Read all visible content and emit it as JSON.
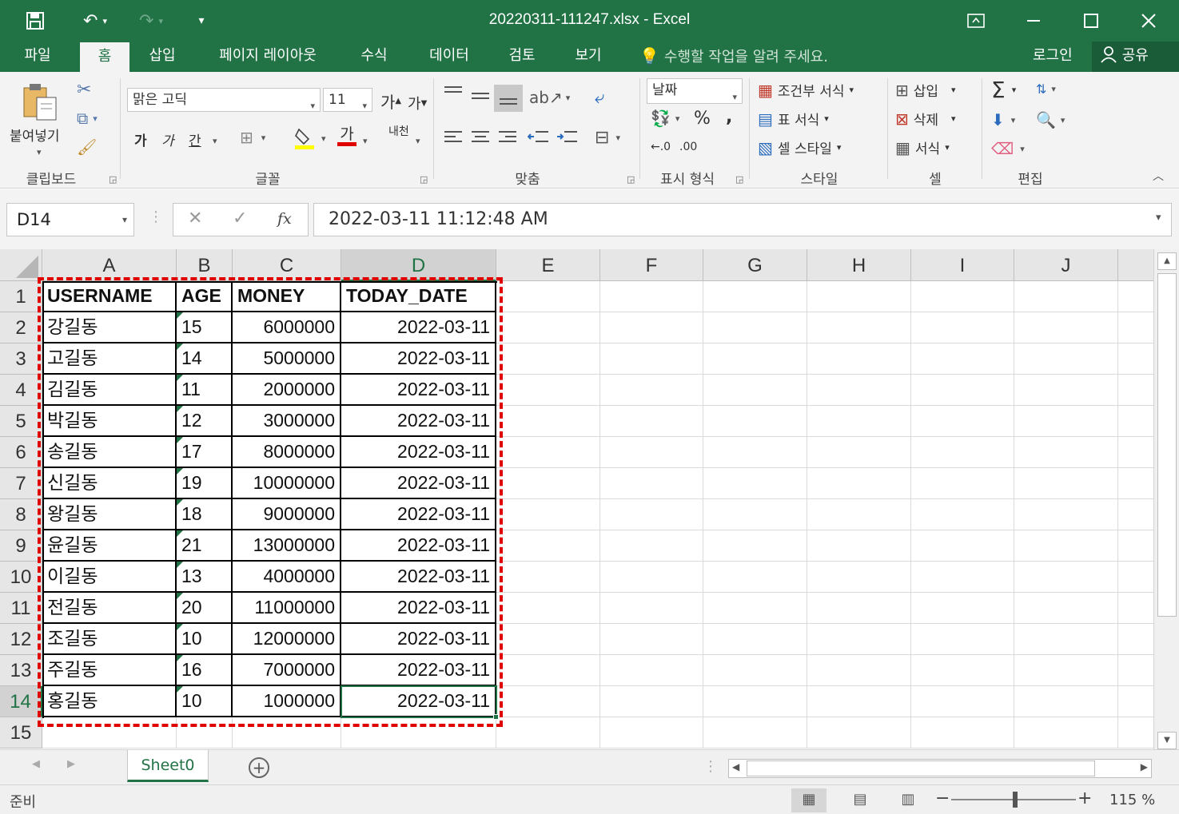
{
  "window": {
    "title": "20220311-111247.xlsx - Excel",
    "qat": {
      "save_icon": "save-icon",
      "undo_icon": "undo-icon",
      "redo_icon": "redo-icon"
    }
  },
  "tabs": [
    "파일",
    "홈",
    "삽입",
    "페이지 레이아웃",
    "수식",
    "데이터",
    "검토",
    "보기"
  ],
  "tell_me": "수행할 작업을 알려 주세요.",
  "login": "로그인",
  "share": "공유",
  "ribbon": {
    "clipboard": {
      "paste": "붙여넣기",
      "label": "클립보드"
    },
    "font": {
      "name": "맑은 고딕",
      "size": "11",
      "bold": "가",
      "italic": "가",
      "underline": "간",
      "grow": "가",
      "shrink": "가",
      "fontcolor": "가",
      "phonetic": "내천",
      "label": "글꼴"
    },
    "align": {
      "label": "맞춤"
    },
    "number": {
      "format": "날짜",
      "percent": "%",
      "comma": ",",
      "inc": "←.0",
      "dec": ".00",
      "label": "표시 형식"
    },
    "styles": {
      "conditional": "조건부 서식",
      "table": "표 서식",
      "cell": "셀 스타일",
      "label": "스타일"
    },
    "cells": {
      "insert": "삽입",
      "delete": "삭제",
      "format": "서식",
      "label": "셀"
    },
    "editing": {
      "sum": "Σ",
      "label": "편집"
    }
  },
  "formula_bar": {
    "name_box": "D14",
    "cancel": "✕",
    "enter": "✓",
    "fx": "fx",
    "value": "2022-03-11  11:12:48 AM"
  },
  "columns": [
    "A",
    "B",
    "C",
    "D",
    "E",
    "F",
    "G",
    "H",
    "I",
    "J"
  ],
  "rows": [
    "1",
    "2",
    "3",
    "4",
    "5",
    "6",
    "7",
    "8",
    "9",
    "10",
    "11",
    "12",
    "13",
    "14",
    "15"
  ],
  "table": {
    "headers": [
      "USERNAME",
      "AGE",
      "MONEY",
      "TODAY_DATE"
    ],
    "data": [
      [
        "강길동",
        "15",
        "6000000",
        "2022-03-11"
      ],
      [
        "고길동",
        "14",
        "5000000",
        "2022-03-11"
      ],
      [
        "김길동",
        "11",
        "2000000",
        "2022-03-11"
      ],
      [
        "박길동",
        "12",
        "3000000",
        "2022-03-11"
      ],
      [
        "송길동",
        "17",
        "8000000",
        "2022-03-11"
      ],
      [
        "신길동",
        "19",
        "10000000",
        "2022-03-11"
      ],
      [
        "왕길동",
        "18",
        "9000000",
        "2022-03-11"
      ],
      [
        "윤길동",
        "21",
        "13000000",
        "2022-03-11"
      ],
      [
        "이길동",
        "13",
        "4000000",
        "2022-03-11"
      ],
      [
        "전길동",
        "20",
        "11000000",
        "2022-03-11"
      ],
      [
        "조길동",
        "10",
        "12000000",
        "2022-03-11"
      ],
      [
        "주길동",
        "16",
        "7000000",
        "2022-03-11"
      ],
      [
        "홍길동",
        "10",
        "1000000",
        "2022-03-11"
      ]
    ]
  },
  "active_cell": "D14",
  "sheet_tab": "Sheet0",
  "status": {
    "ready": "준비",
    "zoom": "115 %",
    "zoom_minus": "−",
    "zoom_plus": "+"
  },
  "colors": {
    "accent": "#217346",
    "highlight": "#e00000"
  }
}
